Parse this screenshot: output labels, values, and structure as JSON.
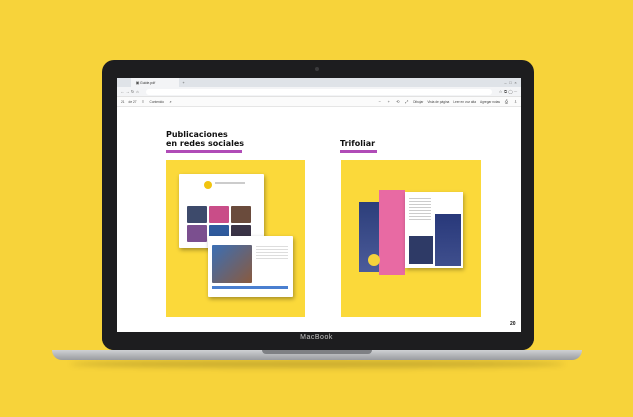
{
  "browser": {
    "tab_title": "Guide.pdf",
    "address": "",
    "toolbar_left": "21",
    "toolbar_pages": "de 27",
    "toolbar_contents": "Contenido",
    "draw_label": "Dibujar",
    "page_view": "Vista de página",
    "read_aloud": "Leer en voz alta",
    "add_notes": "Agregar notas"
  },
  "page": {
    "heading_social": "Publicaciones\nen redes sociales",
    "heading_trifold": "Trifoliar",
    "page_number": "20"
  },
  "laptop": {
    "brand": "MacBook"
  },
  "colors": {
    "background": "#f7d33a",
    "accent_underline": "#b04bb7",
    "panel": "#fbd93a"
  }
}
